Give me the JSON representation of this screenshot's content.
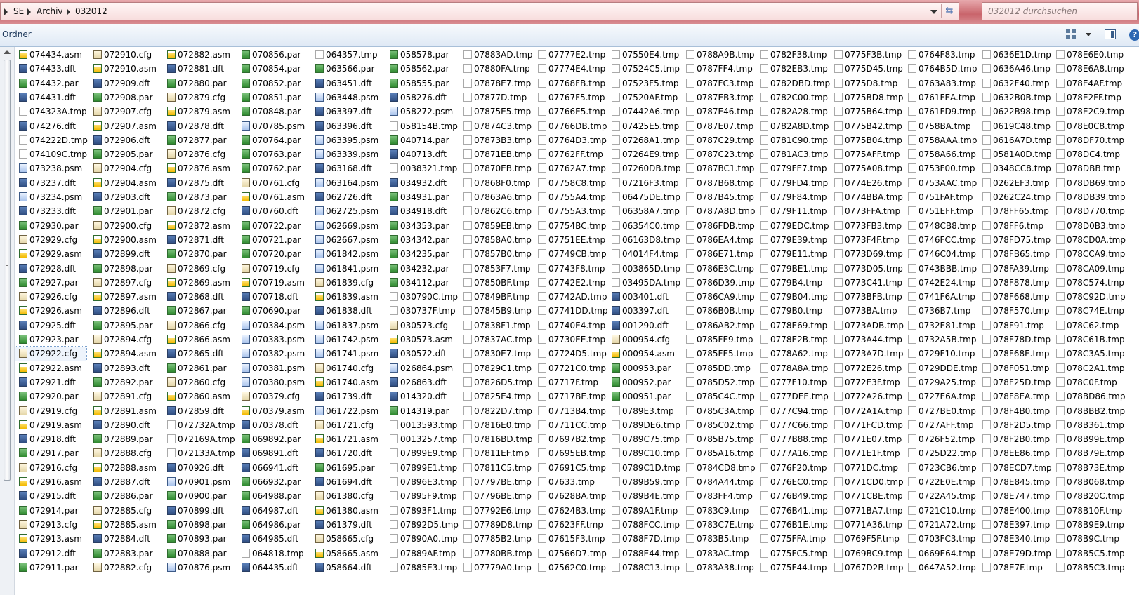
{
  "address_bar": {
    "root_icon": "computer-icon",
    "crumbs": [
      "SE",
      "Archiv",
      "032012"
    ]
  },
  "search": {
    "placeholder": "032012 durchsuchen"
  },
  "toolbar": {
    "organize_label": "Ordner",
    "view_icon": "view-icon",
    "pane_icon": "preview-pane-icon",
    "help_label": "?"
  },
  "colors": {
    "title_red": "#c9646b",
    "toolbar_blue": "#dfe9f5"
  },
  "files": {
    "columns": [
      [
        "074434.asm",
        "074433.dft",
        "074432.par",
        "074431.dft",
        "074323A.tmp",
        "074276.dft",
        "074222D.tmp",
        "074109C.tmp",
        "073238.psm",
        "073237.dft",
        "073234.psm",
        "073233.dft",
        "072930.par",
        "072929.cfg",
        "072929.asm",
        "072928.dft",
        "072927.par",
        "072926.cfg",
        "072926.asm",
        "072925.dft",
        "072923.par",
        "072922.cfg",
        "072922.asm",
        "072921.dft",
        "072920.par",
        "072919.cfg",
        "072919.asm",
        "072918.dft",
        "072917.par",
        "072916.cfg",
        "072916.asm",
        "072915.dft",
        "072914.par",
        "072913.cfg",
        "072913.asm",
        "072912.dft",
        "072911.par"
      ],
      [
        "072910.cfg",
        "072910.asm",
        "072909.dft",
        "072908.par",
        "072907.cfg",
        "072907.asm",
        "072906.dft",
        "072905.par",
        "072904.cfg",
        "072904.asm",
        "072903.dft",
        "072901.par",
        "072900.cfg",
        "072900.asm",
        "072899.dft",
        "072898.par",
        "072897.cfg",
        "072897.asm",
        "072896.dft",
        "072895.par",
        "072894.cfg",
        "072894.asm",
        "072893.dft",
        "072892.par",
        "072891.cfg",
        "072891.asm",
        "072890.dft",
        "072889.par",
        "072888.cfg",
        "072888.asm",
        "072887.dft",
        "072886.par",
        "072885.cfg",
        "072885.asm",
        "072884.dft",
        "072883.par",
        "072882.cfg"
      ],
      [
        "072882.asm",
        "072881.dft",
        "072880.par",
        "072879.cfg",
        "072879.asm",
        "072878.dft",
        "072877.par",
        "072876.cfg",
        "072876.asm",
        "072875.dft",
        "072873.par",
        "072872.cfg",
        "072872.asm",
        "072871.dft",
        "072870.par",
        "072869.cfg",
        "072869.asm",
        "072868.dft",
        "072867.par",
        "072866.cfg",
        "072866.asm",
        "072865.dft",
        "072861.par",
        "072860.cfg",
        "072860.asm",
        "072859.dft",
        "072732A.tmp",
        "072169A.tmp",
        "072133A.tmp",
        "070926.dft",
        "070901.psm",
        "070900.par",
        "070899.dft",
        "070898.par",
        "070893.par",
        "070888.par",
        "070876.psm"
      ],
      [
        "070856.par",
        "070854.par",
        "070852.par",
        "070851.par",
        "070848.par",
        "070785.psm",
        "070764.par",
        "070763.par",
        "070762.par",
        "070761.cfg",
        "070761.asm",
        "070760.dft",
        "070722.par",
        "070721.par",
        "070720.par",
        "070719.cfg",
        "070719.asm",
        "070718.dft",
        "070690.par",
        "070384.psm",
        "070383.psm",
        "070382.psm",
        "070381.psm",
        "070380.psm",
        "070379.cfg",
        "070379.asm",
        "070378.dft",
        "069892.par",
        "069891.dft",
        "066941.dft",
        "066932.par",
        "064988.par",
        "064987.dft",
        "064986.par",
        "064985.dft",
        "064818.tmp",
        "064435.dft"
      ],
      [
        "064357.tmp",
        "063566.par",
        "063451.dft",
        "063448.psm",
        "063397.dft",
        "063396.dft",
        "063395.psm",
        "063339.psm",
        "063168.dft",
        "063164.psm",
        "062726.dft",
        "062725.psm",
        "062669.psm",
        "062667.psm",
        "061842.psm",
        "061841.psm",
        "061839.cfg",
        "061839.asm",
        "061838.dft",
        "061837.psm",
        "061742.psm",
        "061741.psm",
        "061740.cfg",
        "061740.asm",
        "061739.dft",
        "061722.psm",
        "061721.cfg",
        "061721.asm",
        "061720.dft",
        "061695.par",
        "061694.dft",
        "061380.cfg",
        "061380.asm",
        "061379.dft",
        "058665.cfg",
        "058665.asm",
        "058664.dft"
      ],
      [
        "058578.par",
        "058562.par",
        "058555.par",
        "058276.dft",
        "058272.psm",
        "058154B.tmp",
        "040714.par",
        "040713.dft",
        "0038321.tmp",
        "034932.dft",
        "034931.par",
        "034918.dft",
        "034353.par",
        "034342.par",
        "034235.par",
        "034232.par",
        "034112.par",
        "030790C.tmp",
        "030737F.tmp",
        "030573.cfg",
        "030573.asm",
        "030572.dft",
        "026864.psm",
        "026863.dft",
        "014320.dft",
        "014319.par",
        "0013593.tmp",
        "0013257.tmp",
        "07899E9.tmp",
        "07899E1.tmp",
        "07896E3.tmp",
        "07895F9.tmp",
        "07893F1.tmp",
        "07892D5.tmp",
        "07890A0.tmp",
        "07889AF.tmp",
        "07885E3.tmp"
      ],
      [
        "07883AD.tmp",
        "07880FA.tmp",
        "07878E7.tmp",
        "07877D.tmp",
        "07875E5.tmp",
        "07874C3.tmp",
        "07873B3.tmp",
        "07871EB.tmp",
        "07870EB.tmp",
        "07868F0.tmp",
        "07863A6.tmp",
        "07862C6.tmp",
        "07859EB.tmp",
        "07858A0.tmp",
        "07857B0.tmp",
        "07853F7.tmp",
        "07850BF.tmp",
        "07849BF.tmp",
        "07845B9.tmp",
        "07838F1.tmp",
        "07837AC.tmp",
        "07830E7.tmp",
        "07829C1.tmp",
        "07826D5.tmp",
        "07825E4.tmp",
        "07822D7.tmp",
        "07816E0.tmp",
        "07816BD.tmp",
        "07811EF.tmp",
        "07811C5.tmp",
        "07797BE.tmp",
        "07796BE.tmp",
        "07792E6.tmp",
        "07789D8.tmp",
        "07785B2.tmp",
        "07780BB.tmp",
        "07779A0.tmp"
      ],
      [
        "07777E2.tmp",
        "07774E4.tmp",
        "07768FB.tmp",
        "07767F5.tmp",
        "07766E5.tmp",
        "07766DB.tmp",
        "07764D3.tmp",
        "07762FF.tmp",
        "07762A7.tmp",
        "07758C8.tmp",
        "07755A4.tmp",
        "07755A3.tmp",
        "07754BC.tmp",
        "07751EE.tmp",
        "07749CB.tmp",
        "07743F8.tmp",
        "07742E2.tmp",
        "07742AD.tmp",
        "07741DD.tmp",
        "07740E4.tmp",
        "07730EE.tmp",
        "07724D5.tmp",
        "07721C0.tmp",
        "07717F.tmp",
        "07717BE.tmp",
        "07713B4.tmp",
        "07711CC.tmp",
        "07697B2.tmp",
        "07695EB.tmp",
        "07691C5.tmp",
        "07633.tmp",
        "07628BA.tmp",
        "07624B3.tmp",
        "07623FF.tmp",
        "07615F3.tmp",
        "07566D7.tmp",
        "07562C0.tmp"
      ],
      [
        "07550E4.tmp",
        "07524C5.tmp",
        "07523F5.tmp",
        "07520AF.tmp",
        "07442A6.tmp",
        "07425E5.tmp",
        "07268A1.tmp",
        "07264E9.tmp",
        "07260DB.tmp",
        "07216F3.tmp",
        "06475DE.tmp",
        "06358A7.tmp",
        "06354C0.tmp",
        "06163D8.tmp",
        "04014F4.tmp",
        "003865D.tmp",
        "03495DA.tmp",
        "003401.dft",
        "003397.dft",
        "001290.dft",
        "000954.cfg",
        "000954.asm",
        "000953.par",
        "000952.par",
        "000951.par",
        "0789E3.tmp",
        "0789DE6.tmp",
        "0789C75.tmp",
        "0789C10.tmp",
        "0789C1D.tmp",
        "0789B59.tmp",
        "0789B4E.tmp",
        "0789A1F.tmp",
        "0788FCC.tmp",
        "0788F7D.tmp",
        "0788E44.tmp",
        "0788C13.tmp"
      ],
      [
        "0788A9B.tmp",
        "0787FF4.tmp",
        "0787FC3.tmp",
        "0787EB3.tmp",
        "0787E46.tmp",
        "0787E07.tmp",
        "0787C29.tmp",
        "0787C23.tmp",
        "0787BC1.tmp",
        "0787B68.tmp",
        "0787B45.tmp",
        "0787A8D.tmp",
        "0786FDB.tmp",
        "0786EA4.tmp",
        "0786E71.tmp",
        "0786E3C.tmp",
        "0786D39.tmp",
        "0786CA9.tmp",
        "0786B0B.tmp",
        "0786AB2.tmp",
        "0785FE9.tmp",
        "0785FE5.tmp",
        "0785DD.tmp",
        "0785D52.tmp",
        "0785C4C.tmp",
        "0785C3A.tmp",
        "0785C02.tmp",
        "0785B75.tmp",
        "0785A16.tmp",
        "0784CD8.tmp",
        "0784A44.tmp",
        "0783FF4.tmp",
        "0783C9.tmp",
        "0783C7E.tmp",
        "0783B5.tmp",
        "0783AC.tmp",
        "0783A38.tmp"
      ],
      [
        "0782F38.tmp",
        "0782EB3.tmp",
        "0782DBD.tmp",
        "0782C00.tmp",
        "0782A28.tmp",
        "0782A8D.tmp",
        "0781C90.tmp",
        "0781AC3.tmp",
        "0779FE7.tmp",
        "0779FD4.tmp",
        "0779F84.tmp",
        "0779F11.tmp",
        "0779EDC.tmp",
        "0779E39.tmp",
        "0779E11.tmp",
        "0779BE1.tmp",
        "0779B4.tmp",
        "0779B04.tmp",
        "0779B0.tmp",
        "0778E69.tmp",
        "0778E2B.tmp",
        "0778A62.tmp",
        "0778A8A.tmp",
        "0777F10.tmp",
        "0777DEE.tmp",
        "0777C94.tmp",
        "0777C66.tmp",
        "0777B88.tmp",
        "0777A16.tmp",
        "0776F20.tmp",
        "0776EC0.tmp",
        "0776B49.tmp",
        "0776B41.tmp",
        "0776B1E.tmp",
        "0775FFA.tmp",
        "0775FC5.tmp",
        "0775F44.tmp"
      ],
      [
        "0775F3B.tmp",
        "0775D45.tmp",
        "0775D8.tmp",
        "0775BD8.tmp",
        "0775B64.tmp",
        "0775B42.tmp",
        "0775B04.tmp",
        "0775AFF.tmp",
        "0775A08.tmp",
        "0774E26.tmp",
        "0774BBA.tmp",
        "0773FFA.tmp",
        "0773FB3.tmp",
        "0773F4F.tmp",
        "0773D69.tmp",
        "0773D05.tmp",
        "0773C41.tmp",
        "0773BFB.tmp",
        "0773BA.tmp",
        "0773ADB.tmp",
        "0773A44.tmp",
        "0773A7D.tmp",
        "0772E26.tmp",
        "0772E3F.tmp",
        "0772A26.tmp",
        "0772A1A.tmp",
        "0771FCD.tmp",
        "0771E07.tmp",
        "0771E1F.tmp",
        "0771DC.tmp",
        "0771CD0.tmp",
        "0771CBE.tmp",
        "0771BA7.tmp",
        "0771A36.tmp",
        "0769F5F.tmp",
        "0769BC9.tmp",
        "0767D2B.tmp"
      ],
      [
        "0764F83.tmp",
        "0764B5D.tmp",
        "0763A83.tmp",
        "0761FEA.tmp",
        "0761FD9.tmp",
        "0758BA.tmp",
        "0758AAA.tmp",
        "0758A66.tmp",
        "0753F00.tmp",
        "0753AAC.tmp",
        "0751FAF.tmp",
        "0751EFF.tmp",
        "0748CB8.tmp",
        "0746FCC.tmp",
        "0746C04.tmp",
        "0743BBB.tmp",
        "0742E24.tmp",
        "0741F6A.tmp",
        "0736B7.tmp",
        "0732E81.tmp",
        "0732A5B.tmp",
        "0729F10.tmp",
        "0729DDE.tmp",
        "0729A25.tmp",
        "0727E6A.tmp",
        "0727BE0.tmp",
        "0727AFF.tmp",
        "0726F52.tmp",
        "0725D22.tmp",
        "0723CB6.tmp",
        "0722E0E.tmp",
        "0722A45.tmp",
        "0721C10.tmp",
        "0721A72.tmp",
        "0703FC3.tmp",
        "0669E64.tmp",
        "0647A52.tmp"
      ],
      [
        "0636E1D.tmp",
        "0636A46.tmp",
        "0632F40.tmp",
        "0632B0B.tmp",
        "0622B98.tmp",
        "0619C48.tmp",
        "0616A7D.tmp",
        "0581A0D.tmp",
        "0348CC8.tmp",
        "0262EF3.tmp",
        "0262C24.tmp",
        "078FF65.tmp",
        "078FF6.tmp",
        "078FD75.tmp",
        "078FB65.tmp",
        "078FA39.tmp",
        "078F878.tmp",
        "078F668.tmp",
        "078F570.tmp",
        "078F91.tmp",
        "078F78D.tmp",
        "078F68E.tmp",
        "078F051.tmp",
        "078F25D.tmp",
        "078F8EA.tmp",
        "078F4B0.tmp",
        "078F2D5.tmp",
        "078F2B0.tmp",
        "078EE86.tmp",
        "078ECD7.tmp",
        "078E845.tmp",
        "078E747.tmp",
        "078E400.tmp",
        "078E397.tmp",
        "078E340.tmp",
        "078E79D.tmp",
        "078E7F.tmp"
      ],
      [
        "078E6E0.tmp",
        "078E6A8.tmp",
        "078E4AF.tmp",
        "078E2FF.tmp",
        "078E2C9.tmp",
        "078E0C8.tmp",
        "078DF70.tmp",
        "078DC4.tmp",
        "078DBB.tmp",
        "078DB69.tmp",
        "078DB39.tmp",
        "078D770.tmp",
        "078D0B3.tmp",
        "078CD0A.tmp",
        "078CCA9.tmp",
        "078CA09.tmp",
        "078C574.tmp",
        "078C92D.tmp",
        "078C74E.tmp",
        "078C62.tmp",
        "078C61B.tmp",
        "078C3A5.tmp",
        "078C2A1.tmp",
        "078C0F.tmp",
        "078BD86.tmp",
        "078BBB2.tmp",
        "078B361.tmp",
        "078B99E.tmp",
        "078B79E.tmp",
        "078B73E.tmp",
        "078B068.tmp",
        "078B20C.tmp",
        "078B10F.tmp",
        "078B9E9.tmp",
        "078B9C.tmp",
        "078B5C5.tmp",
        "078B5C3.tmp"
      ]
    ],
    "selected": "072922.cfg"
  }
}
